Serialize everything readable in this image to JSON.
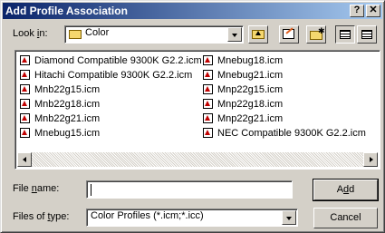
{
  "window": {
    "title": "Add Profile Association",
    "help_label": "?",
    "close_label": "✕"
  },
  "look_in": {
    "label_prefix": "Look ",
    "label_mnemonic": "i",
    "label_suffix": "n:",
    "value": "Color",
    "icons": [
      "folder-icon",
      "up-one-level-icon",
      "desktop-icon",
      "new-folder-icon",
      "list-view-icon",
      "details-view-icon"
    ]
  },
  "files": {
    "left_column": [
      "Diamond Compatible 9300K G2.2.icm",
      "Hitachi Compatible 9300K G2.2.icm",
      "Mnb22g15.icm",
      "Mnb22g18.icm",
      "Mnb22g21.icm",
      "Mnebug15.icm"
    ],
    "right_column": [
      "Mnebug18.icm",
      "Mnebug21.icm",
      "Mnp22g15.icm",
      "Mnp22g18.icm",
      "Mnp22g21.icm",
      "NEC Compatible 9300K G2.2.icm"
    ]
  },
  "file_name": {
    "label_prefix": "File ",
    "label_mnemonic": "n",
    "label_suffix": "ame:",
    "value": ""
  },
  "file_type": {
    "label_prefix": "Files of ",
    "label_mnemonic": "t",
    "label_suffix": "ype:",
    "value": "Color Profiles (*.icm;*.icc)"
  },
  "buttons": {
    "add_prefix": "A",
    "add_mnemonic": "d",
    "add_suffix": "d",
    "cancel": "Cancel"
  },
  "colors": {
    "title_start": "#0a246a",
    "title_end": "#a6caf0",
    "face": "#d4d0c8"
  }
}
